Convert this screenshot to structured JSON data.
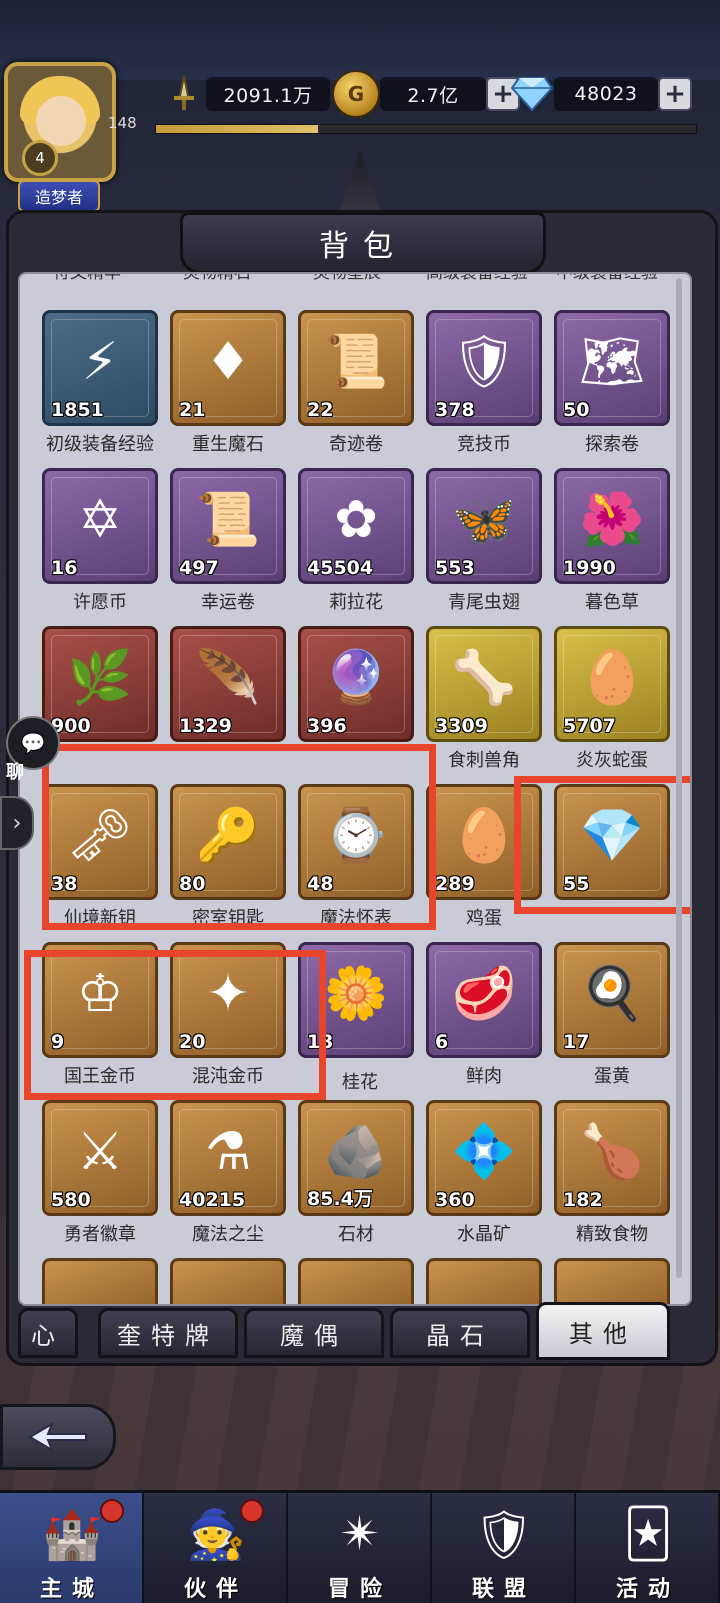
{
  "currency": {
    "power": "2091.1万",
    "gold": "2.7亿",
    "gems": "48023",
    "plus_label": "+"
  },
  "player": {
    "level": "148",
    "rank": "4",
    "title": "造梦者",
    "stars": "◆◆◆◆◆"
  },
  "panel": {
    "title": "背包"
  },
  "cut_labels": [
    "符文精华",
    "灵物精石",
    "灵物星辰",
    "高级装备经验",
    "中级装备经验"
  ],
  "items": [
    {
      "name": "初级装备经验",
      "count": "1851",
      "color": "blue",
      "glyph": "⚡",
      "icon": "lightning-hexagon-icon"
    },
    {
      "name": "重生魔石",
      "count": "21",
      "color": "orange",
      "glyph": "♦",
      "icon": "rebirth-stone-icon"
    },
    {
      "name": "奇迹卷",
      "count": "22",
      "color": "orange",
      "glyph": "📜",
      "icon": "miracle-scroll-icon"
    },
    {
      "name": "竞技币",
      "count": "378",
      "color": "purple",
      "glyph": "🛡",
      "icon": "arena-coin-icon"
    },
    {
      "name": "探索卷",
      "count": "50",
      "color": "purple",
      "glyph": "🗺",
      "icon": "exploration-scroll-icon"
    },
    {
      "name": "许愿币",
      "count": "16",
      "color": "purple",
      "glyph": "✡",
      "icon": "wish-coin-icon"
    },
    {
      "name": "幸运卷",
      "count": "497",
      "color": "purple",
      "glyph": "📜",
      "icon": "luck-scroll-icon"
    },
    {
      "name": "莉拉花",
      "count": "45504",
      "color": "purple",
      "glyph": "✿",
      "icon": "lila-flower-icon"
    },
    {
      "name": "青尾虫翅",
      "count": "553",
      "color": "purple",
      "glyph": "🦋",
      "icon": "insect-wing-icon"
    },
    {
      "name": "暮色草",
      "count": "1990",
      "color": "purple",
      "glyph": "🌺",
      "icon": "dusk-grass-icon"
    },
    {
      "name": "",
      "count": "900",
      "color": "red",
      "glyph": "🌿",
      "icon": "carnivorous-plant-icon"
    },
    {
      "name": "",
      "count": "1329",
      "color": "red",
      "glyph": "🪶",
      "icon": "feather-icon"
    },
    {
      "name": "",
      "count": "396",
      "color": "red",
      "glyph": "🔮",
      "icon": "crystal-orb-icon"
    },
    {
      "name": "食刺兽角",
      "count": "3309",
      "color": "gold",
      "glyph": "🦴",
      "icon": "beast-horn-icon"
    },
    {
      "name": "炎灰蛇蛋",
      "count": "5707",
      "color": "gold",
      "glyph": "🥚",
      "icon": "snake-egg-icon"
    },
    {
      "name": "仙境新钥",
      "count": "38",
      "color": "orange",
      "glyph": "🗝",
      "icon": "wonderland-key-icon"
    },
    {
      "name": "密室钥匙",
      "count": "80",
      "color": "orange",
      "glyph": "🔑",
      "icon": "secret-room-key-icon"
    },
    {
      "name": "魔法怀表",
      "count": "48",
      "color": "orange",
      "glyph": "⌚",
      "icon": "pocket-watch-icon"
    },
    {
      "name": "鸡蛋",
      "count": "289",
      "color": "orange",
      "glyph": "🥚",
      "icon": "eggs-icon"
    },
    {
      "name": "",
      "count": "55",
      "color": "orange",
      "glyph": "💎",
      "icon": "purple-crystal-icon"
    },
    {
      "name": "国王金币",
      "count": "9",
      "color": "orange",
      "glyph": "♔",
      "icon": "king-coin-icon"
    },
    {
      "name": "混沌金币",
      "count": "20",
      "color": "orange",
      "glyph": "✦",
      "icon": "chaos-coin-icon"
    },
    {
      "name": "",
      "count": "13",
      "color": "purple",
      "glyph": "🌼",
      "icon": "osmanthus-icon"
    },
    {
      "name": "鲜肉",
      "count": "6",
      "color": "purple",
      "glyph": "🥩",
      "icon": "fresh-meat-icon"
    },
    {
      "name": "蛋黄",
      "count": "17",
      "color": "orange",
      "glyph": "🍳",
      "icon": "egg-yolk-icon"
    },
    {
      "name": "勇者徽章",
      "count": "580",
      "color": "orange",
      "glyph": "⚔",
      "icon": "hero-badge-icon"
    },
    {
      "name": "魔法之尘",
      "count": "40215",
      "color": "orange",
      "glyph": "⚗",
      "icon": "magic-dust-icon"
    },
    {
      "name": "石材",
      "count": "85.4万",
      "color": "orange",
      "glyph": "🪨",
      "icon": "stone-icon"
    },
    {
      "name": "水晶矿",
      "count": "360",
      "color": "orange",
      "glyph": "💠",
      "icon": "crystal-ore-icon"
    },
    {
      "name": "精致食物",
      "count": "182",
      "color": "orange",
      "glyph": "🍗",
      "icon": "fine-food-icon"
    }
  ],
  "partial_names": {
    "carnivorous": "",
    "feather": "",
    "orb": "",
    "crystal": "",
    "osmanthus": "桂花"
  },
  "tabs": [
    "心",
    "奎特牌",
    "魔偶",
    "晶石",
    "其他"
  ],
  "chat_label": "聊",
  "nav": [
    {
      "label": "主城",
      "glyph": "🏰",
      "icon": "main-city-icon",
      "dot": true
    },
    {
      "label": "伙伴",
      "glyph": "🧙",
      "icon": "partner-icon",
      "dot": true
    },
    {
      "label": "冒险",
      "glyph": "✴",
      "icon": "adventure-icon",
      "dot": false
    },
    {
      "label": "联盟",
      "glyph": "🛡",
      "icon": "alliance-icon",
      "dot": false
    },
    {
      "label": "活动",
      "glyph": "🃏",
      "icon": "activity-icon",
      "dot": false
    }
  ],
  "colors": {
    "highlight": "#e8452c",
    "accent_gold": "#c9a244"
  }
}
